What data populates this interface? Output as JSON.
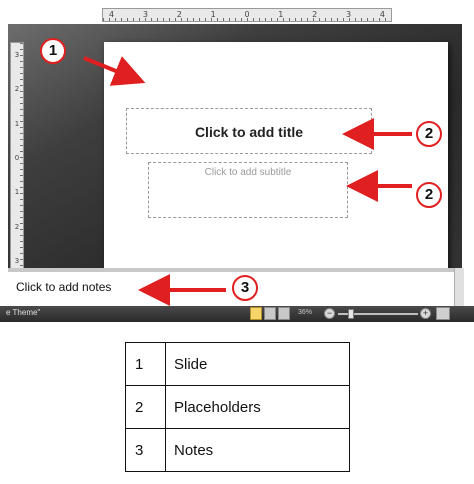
{
  "ruler": {
    "horizontal_ticks": [
      "4",
      "3",
      "2",
      "1",
      "0",
      "1",
      "2",
      "3",
      "4"
    ],
    "vertical_ticks": [
      "3",
      "2",
      "1",
      "0",
      "1",
      "2",
      "3"
    ]
  },
  "slide": {
    "title_placeholder": "Click to add title",
    "subtitle_placeholder": "Click to add subtitle"
  },
  "notes": {
    "placeholder": "Click to add notes"
  },
  "status_bar": {
    "theme": "e Theme\"",
    "zoom": "36%",
    "zoom_out": "−",
    "zoom_in": "+"
  },
  "callouts": {
    "slide": "1",
    "title": "2",
    "subtitle": "2",
    "notes": "3"
  },
  "legend": {
    "rows": [
      {
        "number": "1",
        "label": "Slide"
      },
      {
        "number": "2",
        "label": "Placeholders"
      },
      {
        "number": "3",
        "label": "Notes"
      }
    ]
  },
  "colors": {
    "callout_red": "#e02020",
    "workspace_dark": "#2a2a2a"
  }
}
